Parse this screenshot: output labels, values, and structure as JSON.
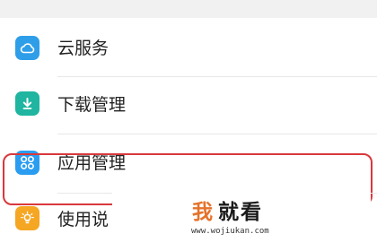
{
  "settings": {
    "items": [
      {
        "label": "云服务",
        "icon": "cloud-icon",
        "icon_color": "#2f9ee8"
      },
      {
        "label": "下载管理",
        "icon": "download-icon",
        "icon_color": "#1fb5a0"
      },
      {
        "label": "应用管理",
        "icon": "apps-grid-icon",
        "icon_color": "#2a9df0"
      },
      {
        "label": "使用说",
        "icon": "lightbulb-icon",
        "icon_color": "#f5a623"
      }
    ]
  },
  "watermark": {
    "char_1": "我",
    "char_rest": "就看",
    "url": "www.wojiukan.com",
    "accent_color": "#e5722a"
  }
}
